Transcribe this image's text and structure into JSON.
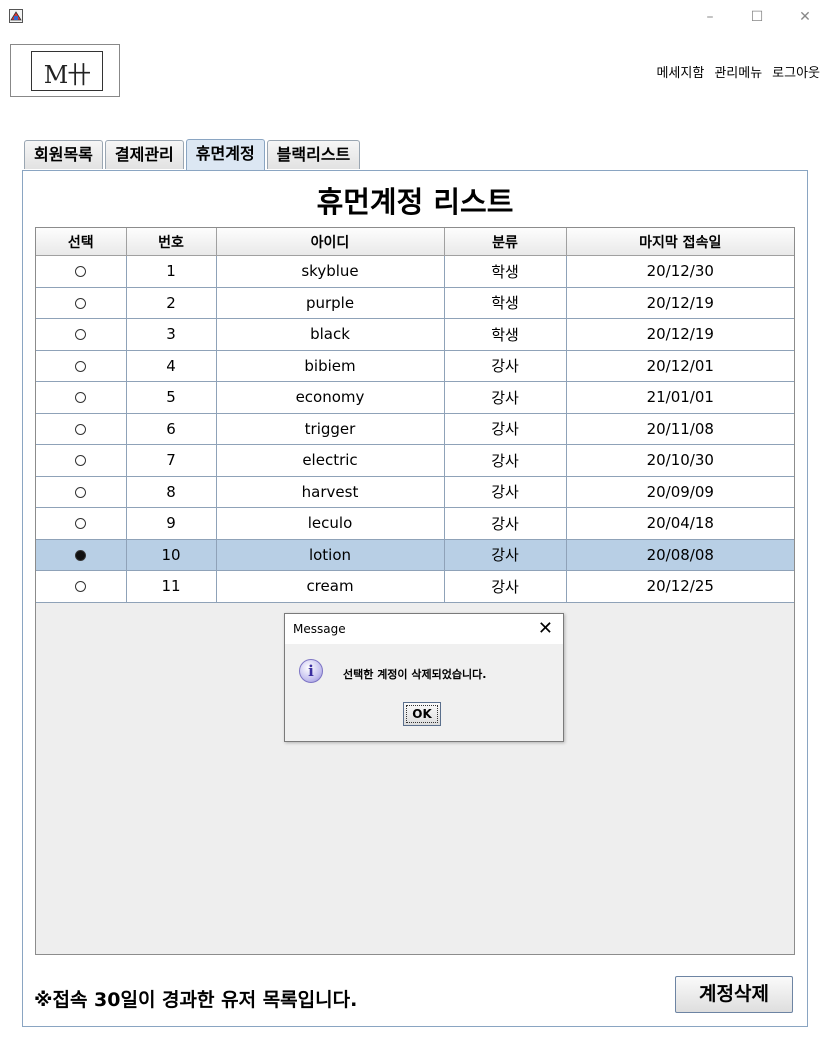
{
  "window": {
    "minimize": "–",
    "maximize": "☐",
    "close": "✕"
  },
  "logo": {
    "text": "M卄"
  },
  "nav": {
    "messages": "메세지함",
    "admin_menu": "관리메뉴",
    "logout": "로그아웃"
  },
  "tabs": [
    {
      "label": "회원목록",
      "active": false
    },
    {
      "label": "결제관리",
      "active": false
    },
    {
      "label": "휴면계정",
      "active": true
    },
    {
      "label": "블랙리스트",
      "active": false
    }
  ],
  "panel": {
    "title": "휴먼계정 리스트"
  },
  "table": {
    "columns": [
      "선택",
      "번호",
      "아이디",
      "분류",
      "마지막 접속일"
    ],
    "rows": [
      {
        "selected": false,
        "no": "1",
        "id": "skyblue",
        "type": "학생",
        "last": "20/12/30"
      },
      {
        "selected": false,
        "no": "2",
        "id": "purple",
        "type": "학생",
        "last": "20/12/19"
      },
      {
        "selected": false,
        "no": "3",
        "id": "black",
        "type": "학생",
        "last": "20/12/19"
      },
      {
        "selected": false,
        "no": "4",
        "id": "bibiem",
        "type": "강사",
        "last": "20/12/01"
      },
      {
        "selected": false,
        "no": "5",
        "id": "economy",
        "type": "강사",
        "last": "21/01/01"
      },
      {
        "selected": false,
        "no": "6",
        "id": "trigger",
        "type": "강사",
        "last": "20/11/08"
      },
      {
        "selected": false,
        "no": "7",
        "id": "electric",
        "type": "강사",
        "last": "20/10/30"
      },
      {
        "selected": false,
        "no": "8",
        "id": "harvest",
        "type": "강사",
        "last": "20/09/09"
      },
      {
        "selected": false,
        "no": "9",
        "id": "leculo",
        "type": "강사",
        "last": "20/04/18"
      },
      {
        "selected": true,
        "no": "10",
        "id": "lotion",
        "type": "강사",
        "last": "20/08/08"
      },
      {
        "selected": false,
        "no": "11",
        "id": "cream",
        "type": "강사",
        "last": "20/12/25"
      }
    ]
  },
  "dialog": {
    "title": "Message",
    "icon": "info-icon",
    "message": "선택한 계정이 삭제되었습니다.",
    "ok": "OK",
    "close": "✕"
  },
  "footer": {
    "note": "※접속 30일이 경과한 유저 목록입니다.",
    "delete_button": "계정삭제"
  },
  "colors": {
    "selected_row": "#b8cfe5",
    "active_tab": "#dce7f3",
    "border": "#8aa5c2"
  }
}
